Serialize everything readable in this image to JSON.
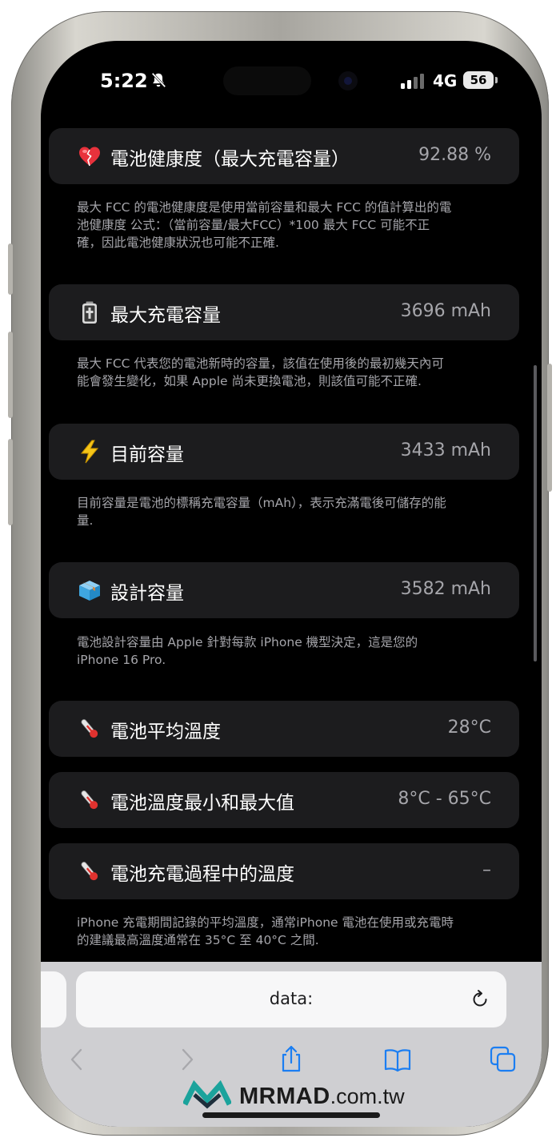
{
  "status_bar": {
    "time": "5:22",
    "network": "4G",
    "battery": "56"
  },
  "rows": [
    {
      "emoji": "heart-icon",
      "label": "電池健康度（最大充電容量）",
      "value": "92.88 %"
    },
    {
      "emoji": "battery-icon",
      "label": "最大充電容量",
      "value": "3696 mAh"
    },
    {
      "emoji": "lightning-icon",
      "label": "目前容量",
      "value": "3433 mAh"
    },
    {
      "emoji": "box-icon",
      "label": "設計容量",
      "value": "3582 mAh"
    },
    {
      "emoji": "thermometer-icon",
      "label": "電池平均溫度",
      "value": "28°C"
    },
    {
      "emoji": "thermometer-icon",
      "label": "電池溫度最小和最大值",
      "value": "8°C - 65°C"
    },
    {
      "emoji": "thermometer-icon",
      "label": "電池充電過程中的溫度",
      "value": "–"
    }
  ],
  "descriptions": {
    "health": [
      "最大 FCC 的電池健康度是使用當前容量和最大 FCC 的值計算出的電",
      "池健康度 公式：（當前容量/最大FCC）*100 最大 FCC 可能不正",
      "確，因此電池健康狀況也可能不正確."
    ],
    "max_capacity": [
      "最大 FCC 代表您的電池新時的容量，該值在使用後的最初幾天內可",
      "能會發生變化，如果 Apple 尚未更換電池，則該值可能不正確."
    ],
    "current_capacity": [
      "目前容量是電池的標稱充電容量（mAh），表示充滿電後可儲存的能",
      "量."
    ],
    "design_capacity": [
      "電池設計容量由 Apple 針對每款 iPhone 機型決定，這是您的",
      "iPhone 16 Pro."
    ],
    "temperature": [
      "iPhone 充電期間記錄的平均溫度，通常iPhone 電池在使用或充電時",
      "的建議最高溫度通常在 35°C 至 40°C 之間."
    ]
  },
  "safari": {
    "url": "data:"
  },
  "watermark": {
    "bold": "MRMAD",
    "light": ".com.tw"
  }
}
